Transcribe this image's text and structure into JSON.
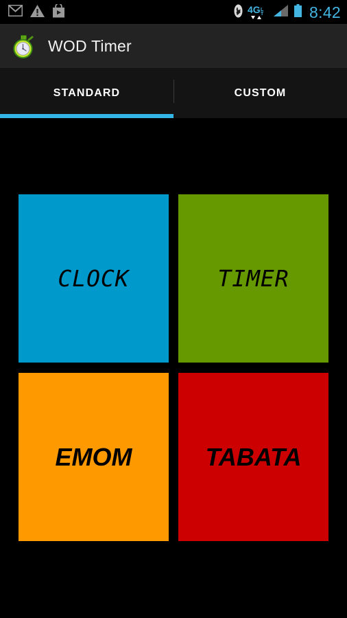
{
  "status_bar": {
    "notification_icons": [
      "gmail-icon",
      "warning-icon",
      "play-store-icon"
    ],
    "system_icons": [
      "bluetooth-icon",
      "4g-lte-icon",
      "signal-bars-icon",
      "battery-icon"
    ],
    "network_label": "4G",
    "network_sub_label": "LTE",
    "time": "8:42",
    "time_color": "#43b5e0"
  },
  "action_bar": {
    "app_icon": "stopwatch-icon",
    "title": "WOD Timer",
    "background": "#232323"
  },
  "tabs": {
    "active_index": 0,
    "indicator_color": "#33b5e5",
    "items": [
      {
        "label": "STANDARD",
        "active": true
      },
      {
        "label": "CUSTOM",
        "active": false
      }
    ]
  },
  "main": {
    "background": "#000000",
    "tiles": [
      {
        "label": "CLOCK",
        "color": "#0099cc",
        "text_color": "#000000",
        "font": "mono"
      },
      {
        "label": "TIMER",
        "color": "#669900",
        "text_color": "#000000",
        "font": "mono"
      },
      {
        "label": "EMOM",
        "color": "#ff9900",
        "text_color": "#000000",
        "font": "sans"
      },
      {
        "label": "TABATA",
        "color": "#cc0000",
        "text_color": "#000000",
        "font": "sans"
      }
    ]
  }
}
